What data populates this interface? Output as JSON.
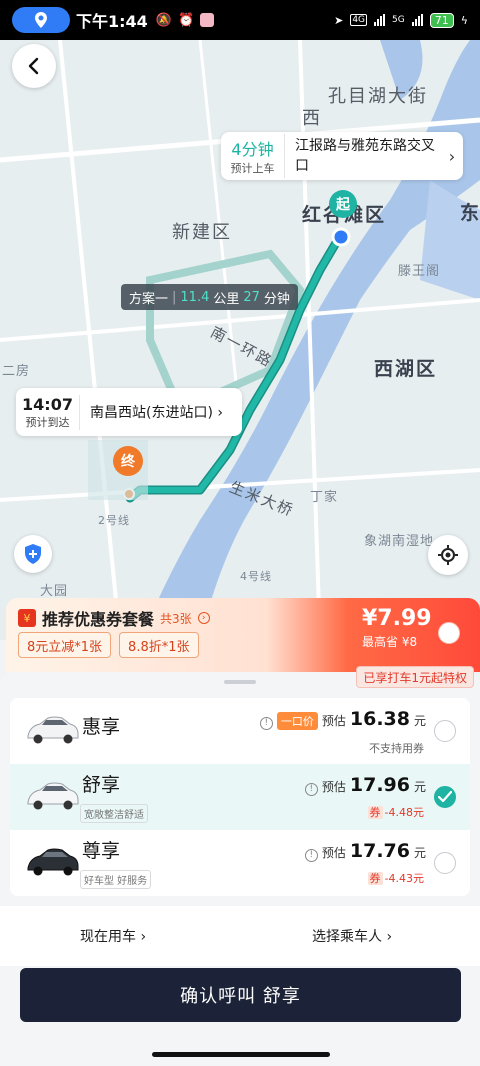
{
  "status_bar": {
    "time": "下午1:44",
    "battery": "71",
    "net1": "4G",
    "net2": "5G"
  },
  "map": {
    "labels": {
      "kongmu": "孔目湖大街",
      "xi": "西",
      "xinjian": "新建区",
      "hongguting": "红谷滩区",
      "dong": "东",
      "tengwang": "滕王阁",
      "xihu": "西湖区",
      "nanyi": "南一环路",
      "shengmi": "生米大桥",
      "dingjia": "丁家",
      "xiangdong": "象湖南湿地",
      "erfang": "二房",
      "dayuan": "大园",
      "road2": "2号线",
      "road4": "4号线"
    },
    "pickup": {
      "minutes": "4分钟",
      "sub": "预计上车",
      "address": "江报路与雅苑东路交叉口"
    },
    "route_chip": {
      "plan": "方案一",
      "distance": "11.4",
      "distance_unit": "公里",
      "time": "27",
      "time_unit": "分钟"
    },
    "arrival": {
      "time": "14:07",
      "sub": "预计到达",
      "address": "南昌西站(东进站口)"
    },
    "start_marker": "起",
    "end_marker": "终"
  },
  "coupon": {
    "title": "推荐优惠券套餐",
    "count": "共3张",
    "tags": [
      "8元立减*1张",
      "8.8折*1张"
    ],
    "price": "¥7.99",
    "save": "最高省 ¥8"
  },
  "privilege": "已享打车1元起特权",
  "cars": [
    {
      "name": "惠享",
      "badge": "一口价",
      "label": "预估",
      "price": "16.38",
      "unit": "元",
      "note": "不支持用券",
      "selected": false
    },
    {
      "name": "舒享",
      "tag": "宽敞整洁舒适",
      "label": "预估",
      "price": "17.96",
      "unit": "元",
      "coupon_q": "券",
      "coupon": "-4.48元",
      "selected": true
    },
    {
      "name": "尊享",
      "tag": "好车型 好服务",
      "label": "预估",
      "price": "17.76",
      "unit": "元",
      "coupon_q": "券",
      "coupon": "-4.43元",
      "selected": false
    }
  ],
  "options": {
    "now": "现在用车",
    "passenger": "选择乘车人"
  },
  "confirm": "确认呼叫 舒享",
  "colors": {
    "accent": "#1fb3a3",
    "route": "#1fb3a3",
    "confirm_bg": "#1c2237",
    "coupon_red": "#ff4a3a"
  }
}
